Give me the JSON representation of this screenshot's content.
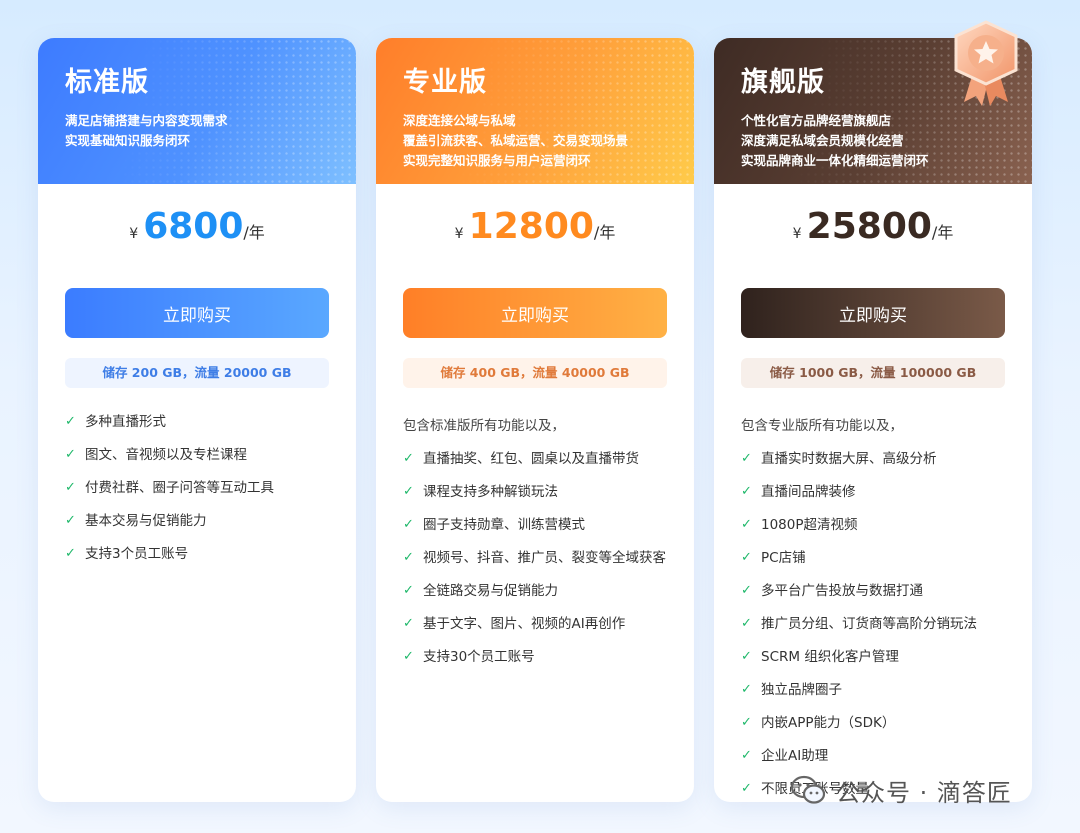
{
  "plans": [
    {
      "title": "标准版",
      "desc": [
        "满足店铺搭建与内容变现需求",
        "实现基础知识服务闭环"
      ],
      "currency": "¥",
      "price": "6800",
      "unit": "/年",
      "button": "立即购买",
      "quota": "储存 200 GB，流量 20000 GB",
      "intro": "",
      "features": [
        "多种直播形式",
        "图文、音视频以及专栏课程",
        "付费社群、圈子问答等互动工具",
        "基本交易与促销能力",
        "支持3个员工账号"
      ]
    },
    {
      "title": "专业版",
      "desc": [
        "深度连接公域与私域",
        "覆盖引流获客、私域运营、交易变现场景",
        "实现完整知识服务与用户运营闭环"
      ],
      "currency": "¥",
      "price": "12800",
      "unit": "/年",
      "button": "立即购买",
      "quota": "储存 400 GB，流量 40000 GB",
      "intro": "包含标准版所有功能以及，",
      "features": [
        "直播抽奖、红包、圆桌以及直播带货",
        "课程支持多种解锁玩法",
        "圈子支持勋章、训练营模式",
        "视频号、抖音、推广员、裂变等全域获客",
        "全链路交易与促销能力",
        "基于文字、图片、视频的AI再创作",
        "支持30个员工账号"
      ]
    },
    {
      "title": "旗舰版",
      "desc": [
        "个性化官方品牌经营旗舰店",
        "深度满足私域会员规模化经营",
        "实现品牌商业一体化精细运营闭环"
      ],
      "currency": "¥",
      "price": "25800",
      "unit": "/年",
      "button": "立即购买",
      "quota": "储存 1000 GB，流量 100000 GB",
      "intro": "包含专业版所有功能以及，",
      "features": [
        "直播实时数据大屏、高级分析",
        "直播间品牌装修",
        "1080P超清视频",
        "PC店铺",
        "多平台广告投放与数据打通",
        "推广员分组、订货商等高阶分销玩法",
        "SCRM 组织化客户管理",
        "独立品牌圈子",
        "内嵌APP能力（SDK）",
        "企业AI助理",
        "不限员工账号数量"
      ]
    }
  ],
  "badge_icon": "star-medal-icon",
  "watermark": {
    "icon": "wechat-icon",
    "text": "公众号 · 滴答匠"
  },
  "colors": {
    "standard": "#3d7bff",
    "pro": "#ff8a1f",
    "flagship": "#5b3f33",
    "check": "#1fb86a"
  }
}
